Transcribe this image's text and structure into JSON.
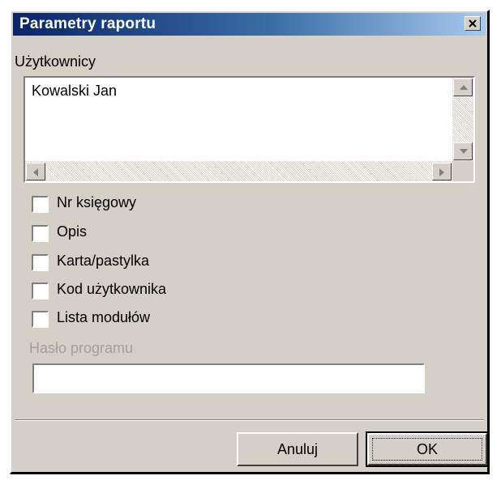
{
  "dialog": {
    "title": "Parametry raportu",
    "close_icon": "close-icon"
  },
  "users": {
    "label": "Użytkownicy",
    "items": [
      "Kowalski Jan"
    ]
  },
  "options": [
    {
      "label": "Nr księgowy",
      "checked": false
    },
    {
      "label": "Opis",
      "checked": false
    },
    {
      "label": "Karta/pastylka",
      "checked": false
    },
    {
      "label": "Kod użytkownika",
      "checked": false
    },
    {
      "label": "Lista modułów",
      "checked": false
    }
  ],
  "password": {
    "label": "Hasło programu",
    "value": ""
  },
  "buttons": {
    "cancel": "Anuluj",
    "ok": "OK"
  },
  "colors": {
    "title_bar_start": "#0a246a",
    "title_bar_end": "#a6caf0",
    "face": "#d4d0c8",
    "disabled_text": "#a0a0a0"
  }
}
